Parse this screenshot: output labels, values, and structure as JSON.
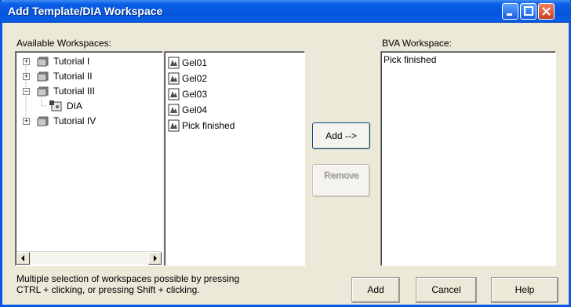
{
  "window": {
    "title": "Add Template/DIA Workspace"
  },
  "labels": {
    "available": "Available Workspaces:",
    "bva": "BVA Workspace:"
  },
  "tree": [
    {
      "label": "Tutorial I",
      "expander": "+"
    },
    {
      "label": "Tutorial II",
      "expander": "+"
    },
    {
      "label": "Tutorial III",
      "expander": "−"
    },
    {
      "label": "DIA",
      "expander": ""
    },
    {
      "label": "Tutorial IV",
      "expander": "+"
    }
  ],
  "workspaces": [
    "Gel01",
    "Gel02",
    "Gel03",
    "Gel04",
    "Pick finished"
  ],
  "bva_items": [
    "Pick finished"
  ],
  "buttons": {
    "add_arrow": "Add -->",
    "remove": "Remove",
    "add": "Add",
    "cancel": "Cancel",
    "help": "Help"
  },
  "hint": {
    "line1": "Multiple selection of workspaces possible by pressing",
    "line2": "CTRL + clicking, or pressing Shift + clicking."
  },
  "colors": {
    "titlebar": "#0553dc",
    "dialog_bg": "#ece9d8",
    "close_button": "#c8401c"
  }
}
